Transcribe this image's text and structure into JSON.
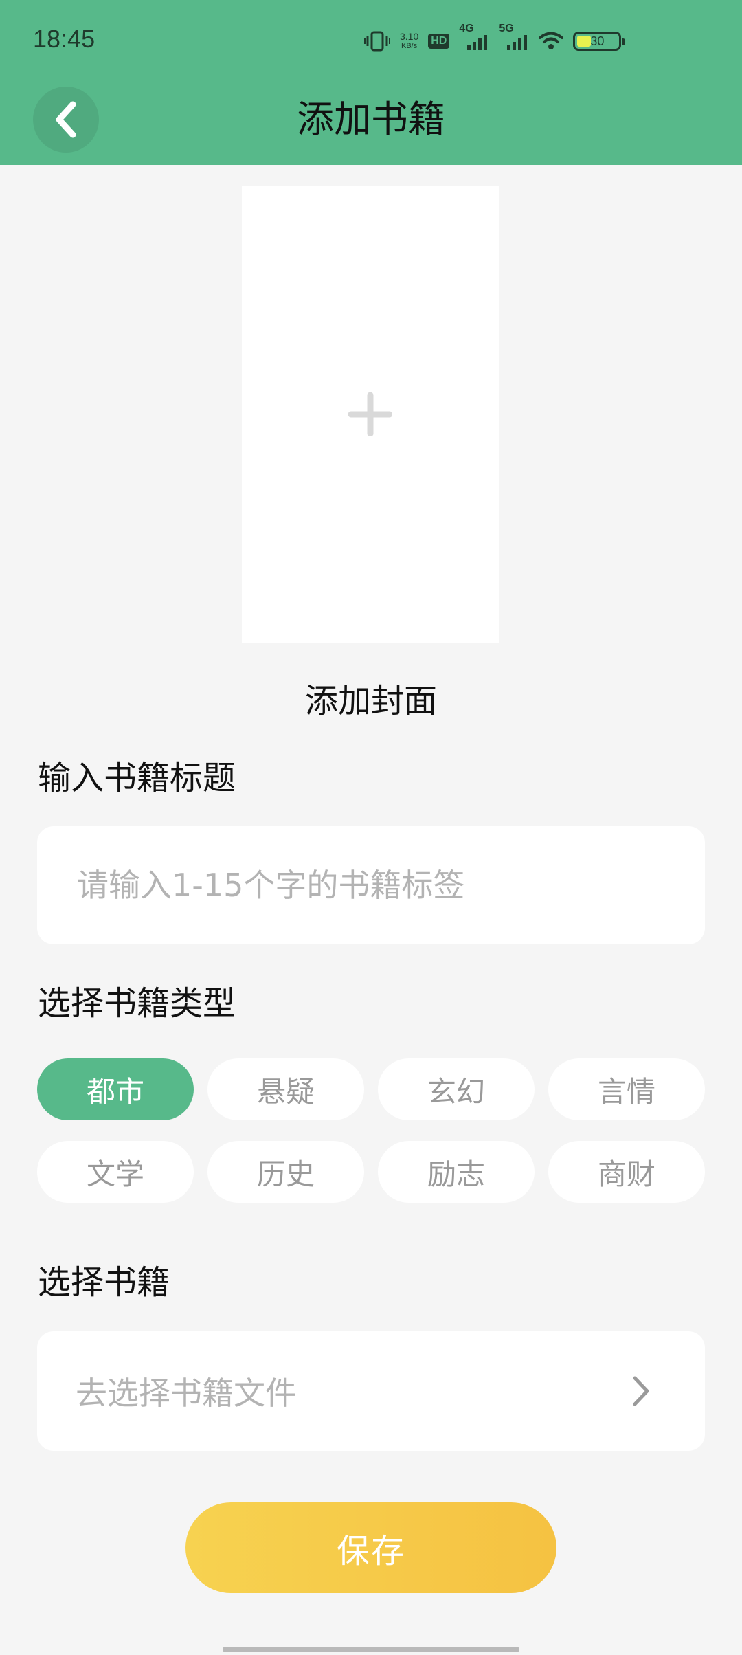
{
  "status_bar": {
    "time": "18:45",
    "net_speed_value": "3.10",
    "net_speed_unit": "KB/s",
    "hd_label": "HD",
    "sim1_label": "4G",
    "sim2_label": "5G",
    "battery_level": "30",
    "battery_fraction": 0.3,
    "battery_fill_color": "#e8f24f"
  },
  "header": {
    "title": "添加书籍",
    "background_color": "#57b98a",
    "back_icon": "chevron-left-icon"
  },
  "cover": {
    "add_icon": "plus-icon",
    "label": "添加封面"
  },
  "title_section": {
    "label": "输入书籍标题",
    "input_value": "",
    "placeholder": "请输入1-15个字的书籍标签"
  },
  "type_section": {
    "label": "选择书籍类型",
    "selected": "都市",
    "tags": [
      "都市",
      "悬疑",
      "玄幻",
      "言情",
      "文学",
      "历史",
      "励志",
      "商财"
    ],
    "active_color": "#57b98a"
  },
  "file_section": {
    "label": "选择书籍",
    "placeholder": "去选择书籍文件",
    "chevron_icon": "chevron-right-icon"
  },
  "save_button": {
    "label": "保存",
    "color": "#f6c847"
  }
}
